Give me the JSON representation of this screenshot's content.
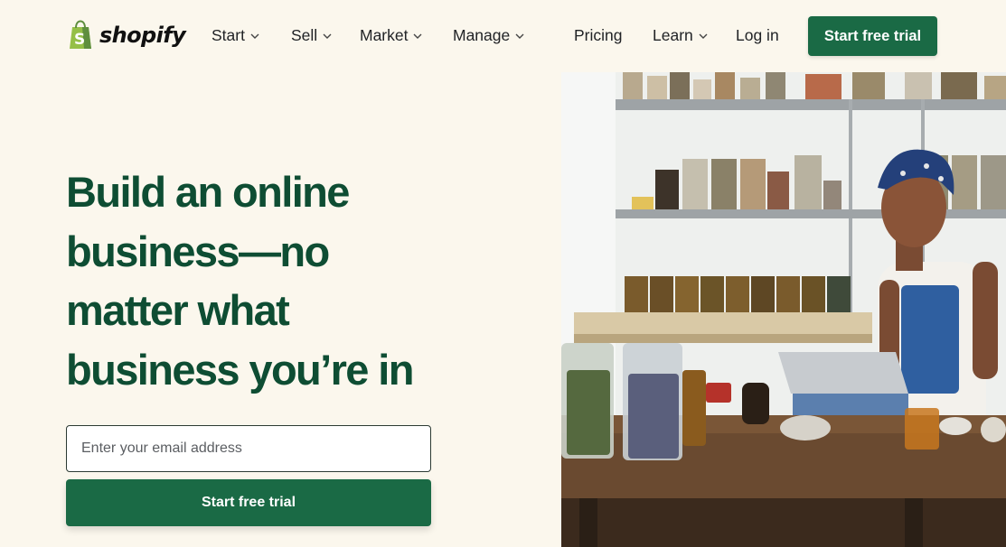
{
  "brand": {
    "name": "shopify",
    "logo_icon": "shopping-bag-icon",
    "color": "#95bf47"
  },
  "nav": {
    "items": [
      {
        "label": "Start",
        "dropdown": true
      },
      {
        "label": "Sell",
        "dropdown": true
      },
      {
        "label": "Market",
        "dropdown": true
      },
      {
        "label": "Manage",
        "dropdown": true
      },
      {
        "label": "Pricing",
        "dropdown": false
      },
      {
        "label": "Learn",
        "dropdown": true
      },
      {
        "label": "Log in",
        "dropdown": false
      }
    ],
    "cta_label": "Start free trial"
  },
  "hero": {
    "headline_lines": [
      "Build an online",
      "business—no",
      "matter what",
      "business you’re in"
    ],
    "email_placeholder": "Enter your email address",
    "email_value": "",
    "cta_label": "Start free trial"
  },
  "colors": {
    "background": "#fbf7ed",
    "accent": "#1a6a45",
    "headline": "#0e4d33"
  }
}
